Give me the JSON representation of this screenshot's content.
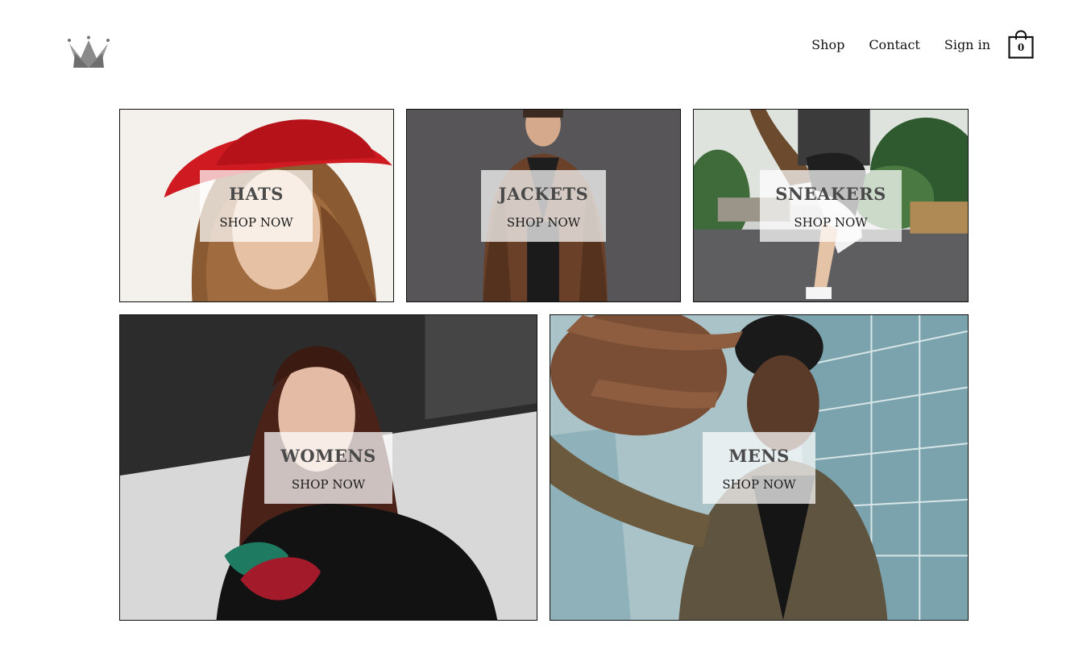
{
  "header": {
    "logo_icon": "crown-icon",
    "nav": {
      "shop": "Shop",
      "contact": "Contact",
      "sign_in": "Sign in"
    },
    "cart": {
      "icon": "shopping-bag-icon",
      "count": "0"
    }
  },
  "directory": [
    {
      "title": "HATS",
      "subtitle": "SHOP NOW"
    },
    {
      "title": "JACKETS",
      "subtitle": "SHOP NOW"
    },
    {
      "title": "SNEAKERS",
      "subtitle": "SHOP NOW"
    },
    {
      "title": "WOMENS",
      "subtitle": "SHOP NOW"
    },
    {
      "title": "MENS",
      "subtitle": "SHOP NOW"
    }
  ],
  "colors": {
    "text": "#111111",
    "label_title": "#4a4a4a",
    "logo": "#808080"
  }
}
